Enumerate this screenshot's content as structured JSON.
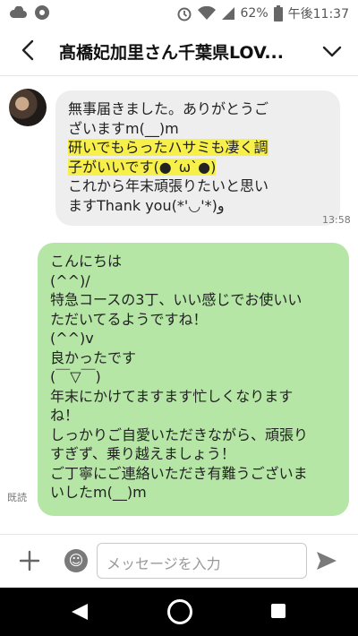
{
  "status_bar": {
    "battery": "62%",
    "time": "午後11:37"
  },
  "header": {
    "title": "髙橋妃加里さん千葉県LOV..."
  },
  "messages": {
    "incoming": {
      "lines": [
        "無事届きました。ありがとうご",
        "ざいますm(__)m",
        "研いでもらったハサミも凄く調",
        "子がいいです(●´ω`●)",
        "これから年末頑張りたいと思い",
        "ますThank you(*'◡'*)ﻭ"
      ],
      "time": "13:58"
    },
    "outgoing": {
      "lines": [
        "こんにちは",
        "(^^)/",
        "特急コースの3丁、いい感じでお使いい",
        "ただいてるようですね！",
        "(^^)v",
        "良かったです",
        "(￣▽￣)",
        "年末にかけてますます忙しくなります",
        "ね！",
        "しっかりご自愛いただきながら、頑張り",
        "すぎず、乗り越えましょう！",
        "ご丁寧にご連絡いただき有難うございま",
        "いしたm(__)m"
      ],
      "read_label": "既読"
    }
  },
  "input": {
    "placeholder": "メッセージを入力"
  },
  "colors": {
    "incoming_bubble": "#eeeeee",
    "outgoing_bubble": "#b5e6a6",
    "highlight": "#f8f04a"
  },
  "icons": {
    "status_left": [
      "cloud-icon",
      "settings-icon"
    ],
    "status_right": [
      "alarm-icon",
      "wifi-icon",
      "signal-icon",
      "battery-icon"
    ],
    "header": [
      "back-arrow-icon",
      "chevron-down-icon"
    ],
    "input": [
      "plus-icon",
      "emoji-icon",
      "send-icon"
    ],
    "nav": [
      "nav-back-icon",
      "nav-home-icon",
      "nav-recent-icon"
    ]
  }
}
